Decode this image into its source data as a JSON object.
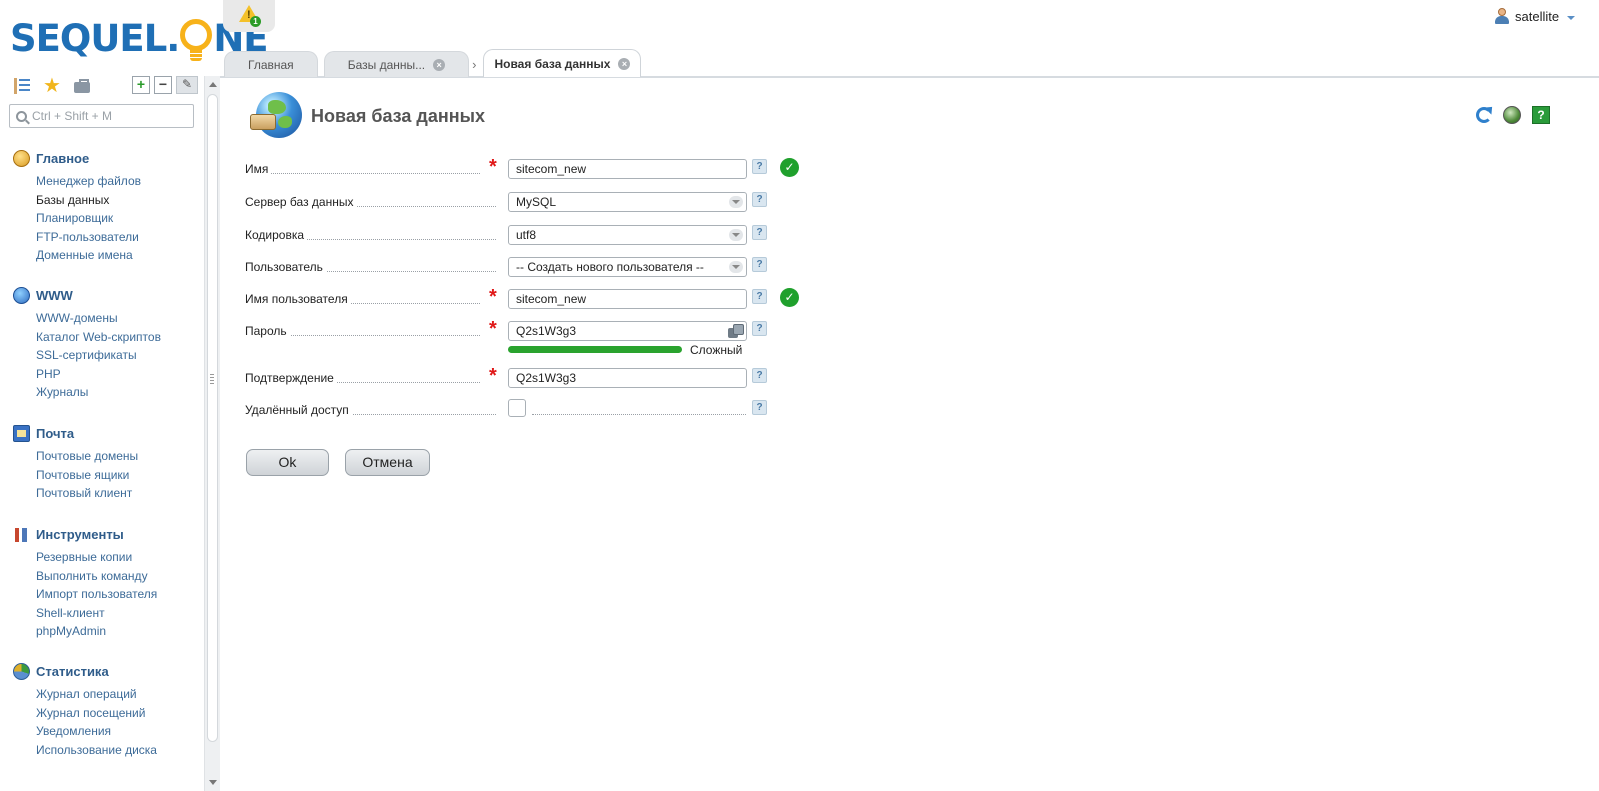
{
  "brand": {
    "logo_left": "SEQUEL.",
    "logo_right": "NE"
  },
  "topbar": {
    "notification_count": "1",
    "user_name": "satellite"
  },
  "tabs": [
    {
      "label": "Главная"
    },
    {
      "label": "Базы данны..."
    },
    {
      "label": "Новая база данных"
    }
  ],
  "sidebar": {
    "search_placeholder": "Ctrl + Shift + M",
    "sections": [
      {
        "title": "Главное",
        "icon": "home-icon",
        "items": [
          "Менеджер файлов",
          "Базы данных",
          "Планировщик",
          "FTP-пользователи",
          "Доменные имена"
        ]
      },
      {
        "title": "WWW",
        "icon": "globe-icon",
        "items": [
          "WWW-домены",
          "Каталог Web-скриптов",
          "SSL-сертификаты",
          "PHP",
          "Журналы"
        ]
      },
      {
        "title": "Почта",
        "icon": "mail-icon",
        "items": [
          "Почтовые домены",
          "Почтовые ящики",
          "Почтовый клиент"
        ]
      },
      {
        "title": "Инструменты",
        "icon": "tools-icon",
        "items": [
          "Резервные копии",
          "Выполнить команду",
          "Импорт пользователя",
          "Shell-клиент",
          "phpMyAdmin"
        ]
      },
      {
        "title": "Статистика",
        "icon": "stats-icon",
        "items": [
          "Журнал операций",
          "Журнал посещений",
          "Уведомления",
          "Использование диска"
        ]
      }
    ]
  },
  "page": {
    "title": "Новая база данных"
  },
  "form": {
    "name_label": "Имя",
    "name_value": "sitecom_new",
    "server_label": "Сервер баз данных",
    "server_value": "MySQL",
    "encoding_label": "Кодировка",
    "encoding_value": "utf8",
    "user_label": "Пользователь",
    "user_value": "-- Создать нового пользователя --",
    "username_label": "Имя пользователя",
    "username_value": "sitecom_new",
    "password_label": "Пароль",
    "password_value": "Q2s1W3g3",
    "password_strength_label": "Сложный",
    "password_strength": 1.0,
    "confirm_label": "Подтверждение",
    "confirm_value": "Q2s1W3g3",
    "remote_label": "Удалённый доступ",
    "remote_checked": false,
    "required_mark": "*",
    "help_mark": "?",
    "valid_mark": "✓"
  },
  "buttons": {
    "ok": "Ok",
    "cancel": "Отмена"
  },
  "colors": {
    "brand_blue": "#1f6fb5",
    "brand_yellow": "#f7b21a",
    "link": "#3d6b98",
    "section_title": "#2f5c8a",
    "strength_bar": "#2aa32e",
    "valid_green": "#1fa02c",
    "required_red": "#e01818"
  }
}
